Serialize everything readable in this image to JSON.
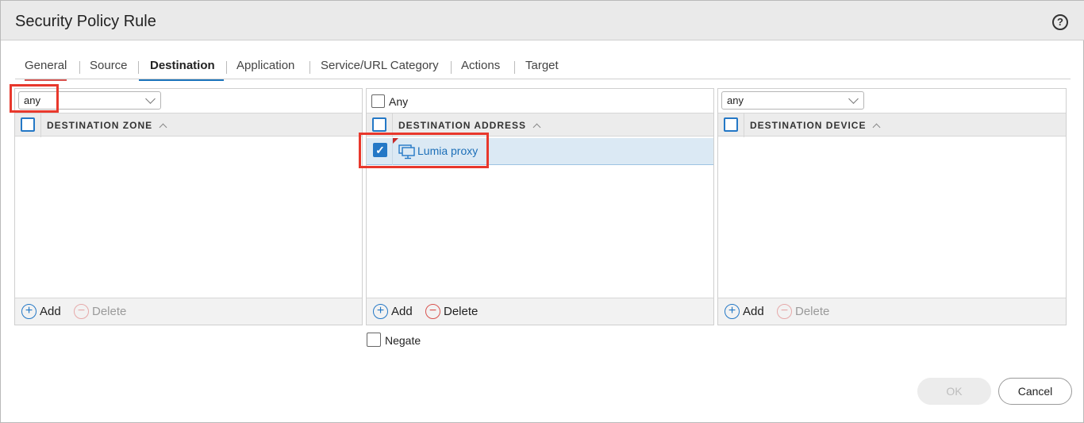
{
  "dialog": {
    "title": "Security Policy Rule",
    "help_icon": "question-circle-icon"
  },
  "tabs": [
    {
      "label": "General"
    },
    {
      "label": "Source"
    },
    {
      "label": "Destination",
      "active": true
    },
    {
      "label": "Application"
    },
    {
      "label": "Service/URL Category"
    },
    {
      "label": "Actions"
    },
    {
      "label": "Target"
    }
  ],
  "zone_panel": {
    "select_value": "any",
    "column_header": "DESTINATION ZONE",
    "add_label": "Add",
    "delete_label": "Delete"
  },
  "address_panel": {
    "any_label": "Any",
    "column_header": "DESTINATION ADDRESS",
    "rows": [
      {
        "label": "Lumia proxy",
        "checked": true,
        "icon": "address-object-icon"
      }
    ],
    "add_label": "Add",
    "delete_label": "Delete",
    "negate_label": "Negate"
  },
  "device_panel": {
    "select_value": "any",
    "column_header": "DESTINATION DEVICE",
    "add_label": "Add",
    "delete_label": "Delete"
  },
  "footer": {
    "ok_label": "OK",
    "cancel_label": "Cancel"
  },
  "colors": {
    "accent": "#2478c6",
    "highlight": "#e8382c",
    "delete_red": "#d9534f"
  }
}
